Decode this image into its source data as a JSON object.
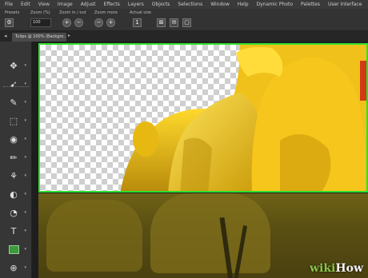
{
  "menu": [
    "File",
    "Edit",
    "View",
    "Image",
    "Adjust",
    "Effects",
    "Layers",
    "Objects",
    "Selections",
    "Window",
    "Help",
    "Dynamic Photo",
    "Palettes",
    "User Interface"
  ],
  "tool_options": {
    "presets_label": "Presets",
    "zoom_label": "Zoom (%)",
    "zoom_value": "100",
    "zoom_steps_label": "Zoom in / out",
    "zoom_more_label": "Zoom more",
    "actual_size_label": "Actual size"
  },
  "tab": {
    "title": "Tulips @ 100% (Backgro..."
  },
  "tools": [
    "pan-icon",
    "pick-icon",
    "eyedropper-icon",
    "selection-icon",
    "redeye-icon",
    "brush-icon",
    "clone-icon",
    "dodge-icon",
    "text-icon",
    "shape-icon",
    "warp-icon"
  ],
  "watermark": {
    "prefix": "wiki",
    "suffix": "How"
  },
  "colors": {
    "selection_outline": "#2ee02e",
    "petal": "#f2c318",
    "petal_shadow": "#c79b0b"
  }
}
